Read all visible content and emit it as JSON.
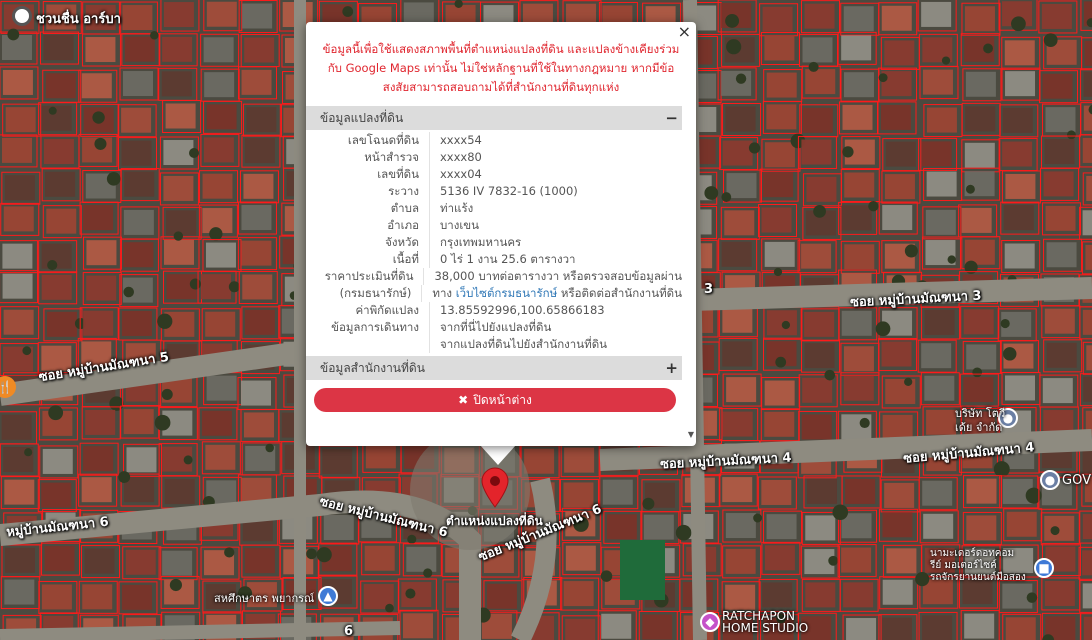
{
  "map": {
    "streets": {
      "top_left": "ชวนชื่น อาร์บา",
      "mid_right_3": "ซอย หมู่บ้านมัณฑนา 3",
      "right_3_edge": "3",
      "left_5": "ซอย หมู่บ้านมัณฑนา 5",
      "mid_4": "ซอย หมู่บ้านมัณฑนา 4",
      "right_4": "ซอย หมู่บ้านมัณฑนา 4",
      "left_6": "หมู่บ้านมัณฑนา 6",
      "curve_6a": "ซอย หมู่บ้านมัณฑนา 6",
      "curve_6b": "ซอย หมู่บ้านมัณฑนา 6",
      "bottom_6": "6"
    },
    "marker_label": "ตำแหน่งแปลงที่ดิน",
    "pois": {
      "company": "บริษัท โตวี\nเด้ย จำกัด",
      "gov": "GOV",
      "school": "สหศึกษาตร พยากรณ์",
      "motor": "นามะเดอร์ดอทคอม\nรีย์ มอเตอร์ไซค์\nรถจักรยานยนต์มือสอง",
      "studio": "RATCHAPON\nHOME STUDIO"
    }
  },
  "popup": {
    "disclaimer": "ข้อมูลนี้เพื่อใช้แสดงสภาพพื้นที่ตำแหน่งแปลงที่ดิน และแปลงข้างเคียงร่วมกับ Google Maps เท่านั้น ไม่ใช่หลักฐานที่ใช้ในทางกฎหมาย หากมีข้อสงสัยสามารถสอบถามได้ที่สำนักงานที่ดินทุกแห่ง",
    "close_symbol": "×",
    "section1_title": "ข้อมูลแปลงที่ดิน",
    "section1_toggle": "−",
    "rows": {
      "deed_no_label": "เลขโฉนดที่ดิน",
      "deed_no": "xxxx54",
      "survey_label": "หน้าสำรวจ",
      "survey": "xxxx80",
      "land_no_label": "เลขที่ดิน",
      "land_no": "xxxx04",
      "sheet_label": "ระวาง",
      "sheet": "5136 IV 7832-16 (1000)",
      "subdistrict_label": "ตำบล",
      "subdistrict": "ท่าแร้ง",
      "district_label": "อำเภอ",
      "district": "บางเขน",
      "province_label": "จังหวัด",
      "province": "กรุงเทพมหานคร",
      "area_label": "เนื้อที่",
      "area": "0 ไร่ 1 งาน 25.6 ตารางวา",
      "price_label": "ราคาประเมินที่ดิน",
      "price": "38,000 บาทต่อตารางวา หรือตรวจสอบข้อมูลผ่าน",
      "treasury_label": "(กรมธนารักษ์)",
      "treasury_prefix": "ทาง",
      "treasury_link": "เว็บไซต์กรมธนารักษ์",
      "treasury_suffix": "หรือติดต่อสำนักงานที่ดิน",
      "coord_label": "ค่าพิกัดแปลง",
      "coord": "13.85592996,100.65866183",
      "travel_label": "ข้อมูลการเดินทาง",
      "travel_1": "จากที่นี่ไปยังแปลงที่ดิน",
      "travel_2": "จากแปลงที่ดินไปยังสำนักงานที่ดิน"
    },
    "section2_title": "ข้อมูลสำนักงานที่ดิน",
    "section2_toggle": "+",
    "close_button": "ปิดหน้าต่าง",
    "close_button_icon": "✖"
  }
}
